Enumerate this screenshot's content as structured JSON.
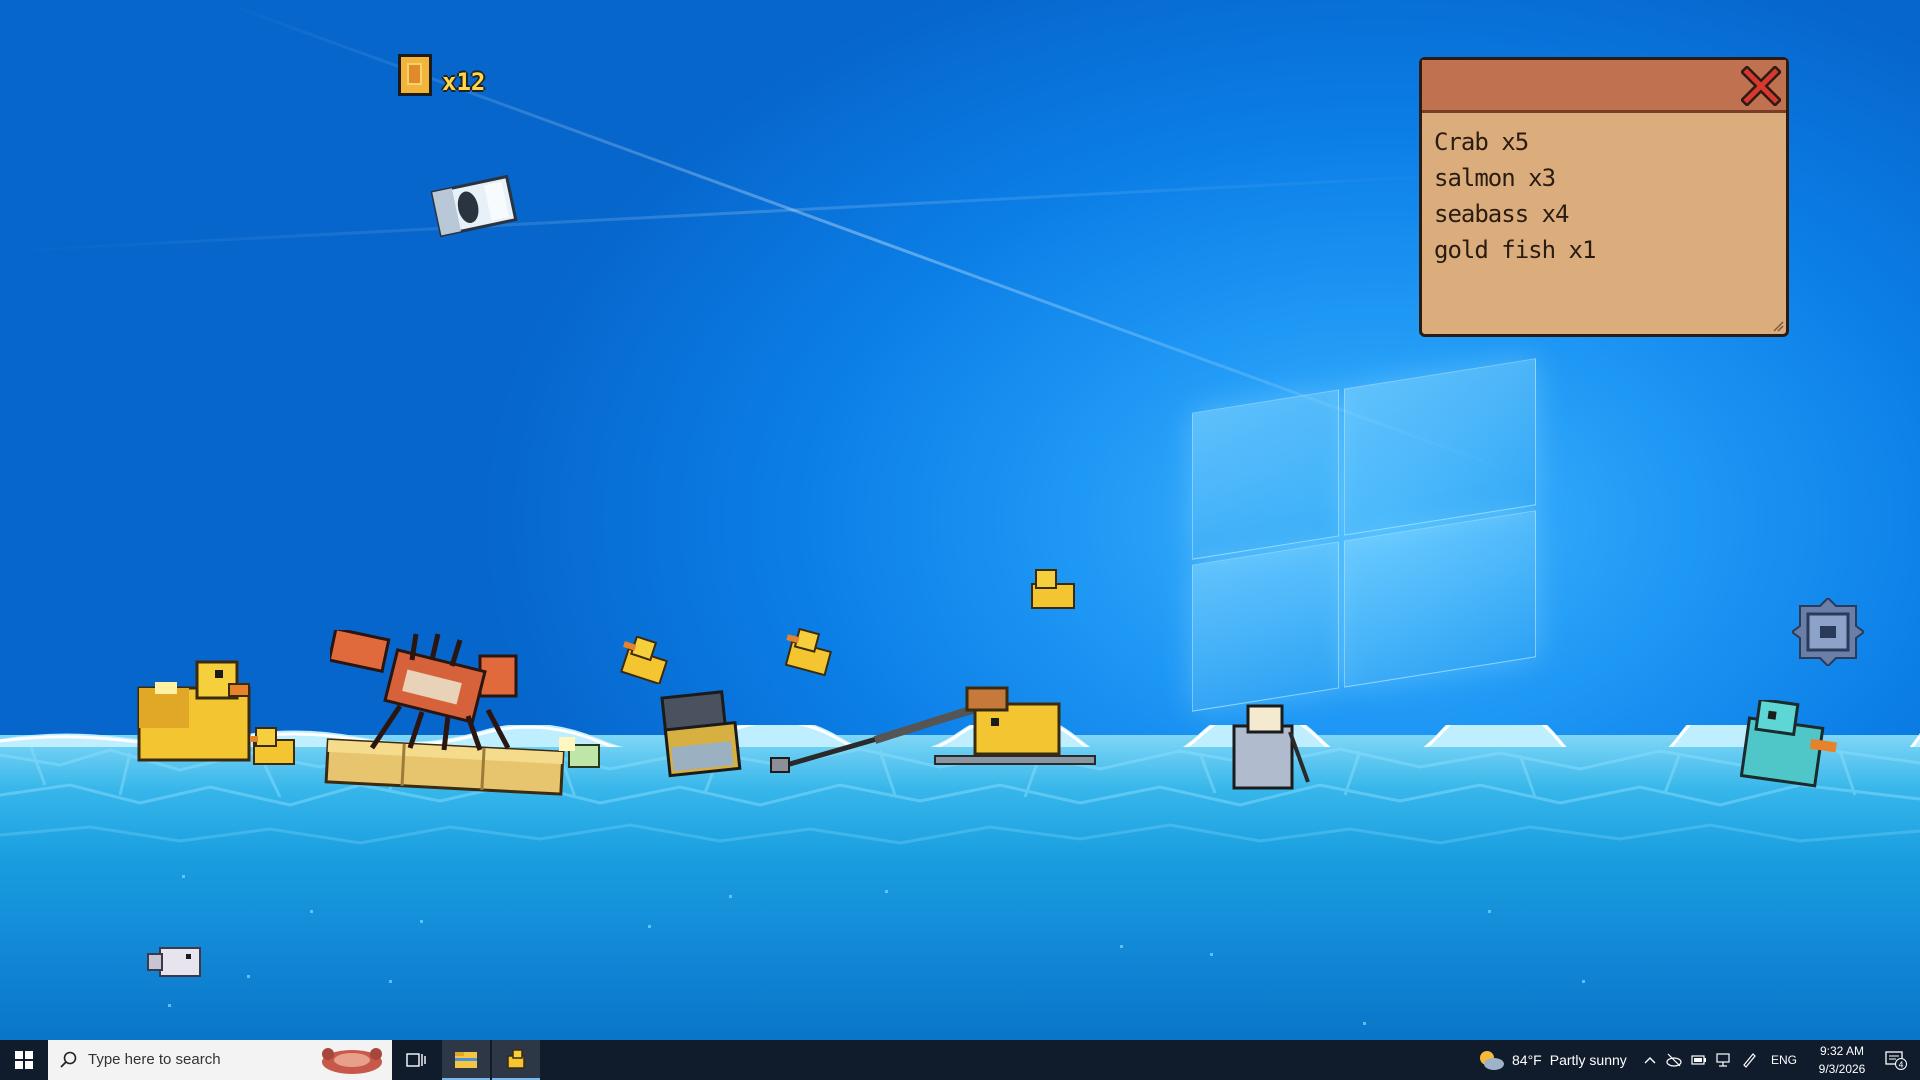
{
  "hud": {
    "coin_count": "x12"
  },
  "inventory": {
    "items": [
      "Crab x5",
      "salmon x3",
      "seabass x4",
      "gold fish x1"
    ]
  },
  "taskbar": {
    "search_placeholder": "Type here to search",
    "weather": {
      "temperature": "84°F",
      "condition": "Partly sunny"
    },
    "language": "ENG",
    "clock": {
      "time": "9:32 AM",
      "date": "9/3/2026"
    },
    "notification_count": "4"
  },
  "colors": {
    "inventory_bg": "#dcad7c",
    "inventory_titlebar": "#c0714f",
    "coin_text": "#ffd84a",
    "taskbar_bg": "#101c2c",
    "duck_yellow": "#f2c531"
  }
}
